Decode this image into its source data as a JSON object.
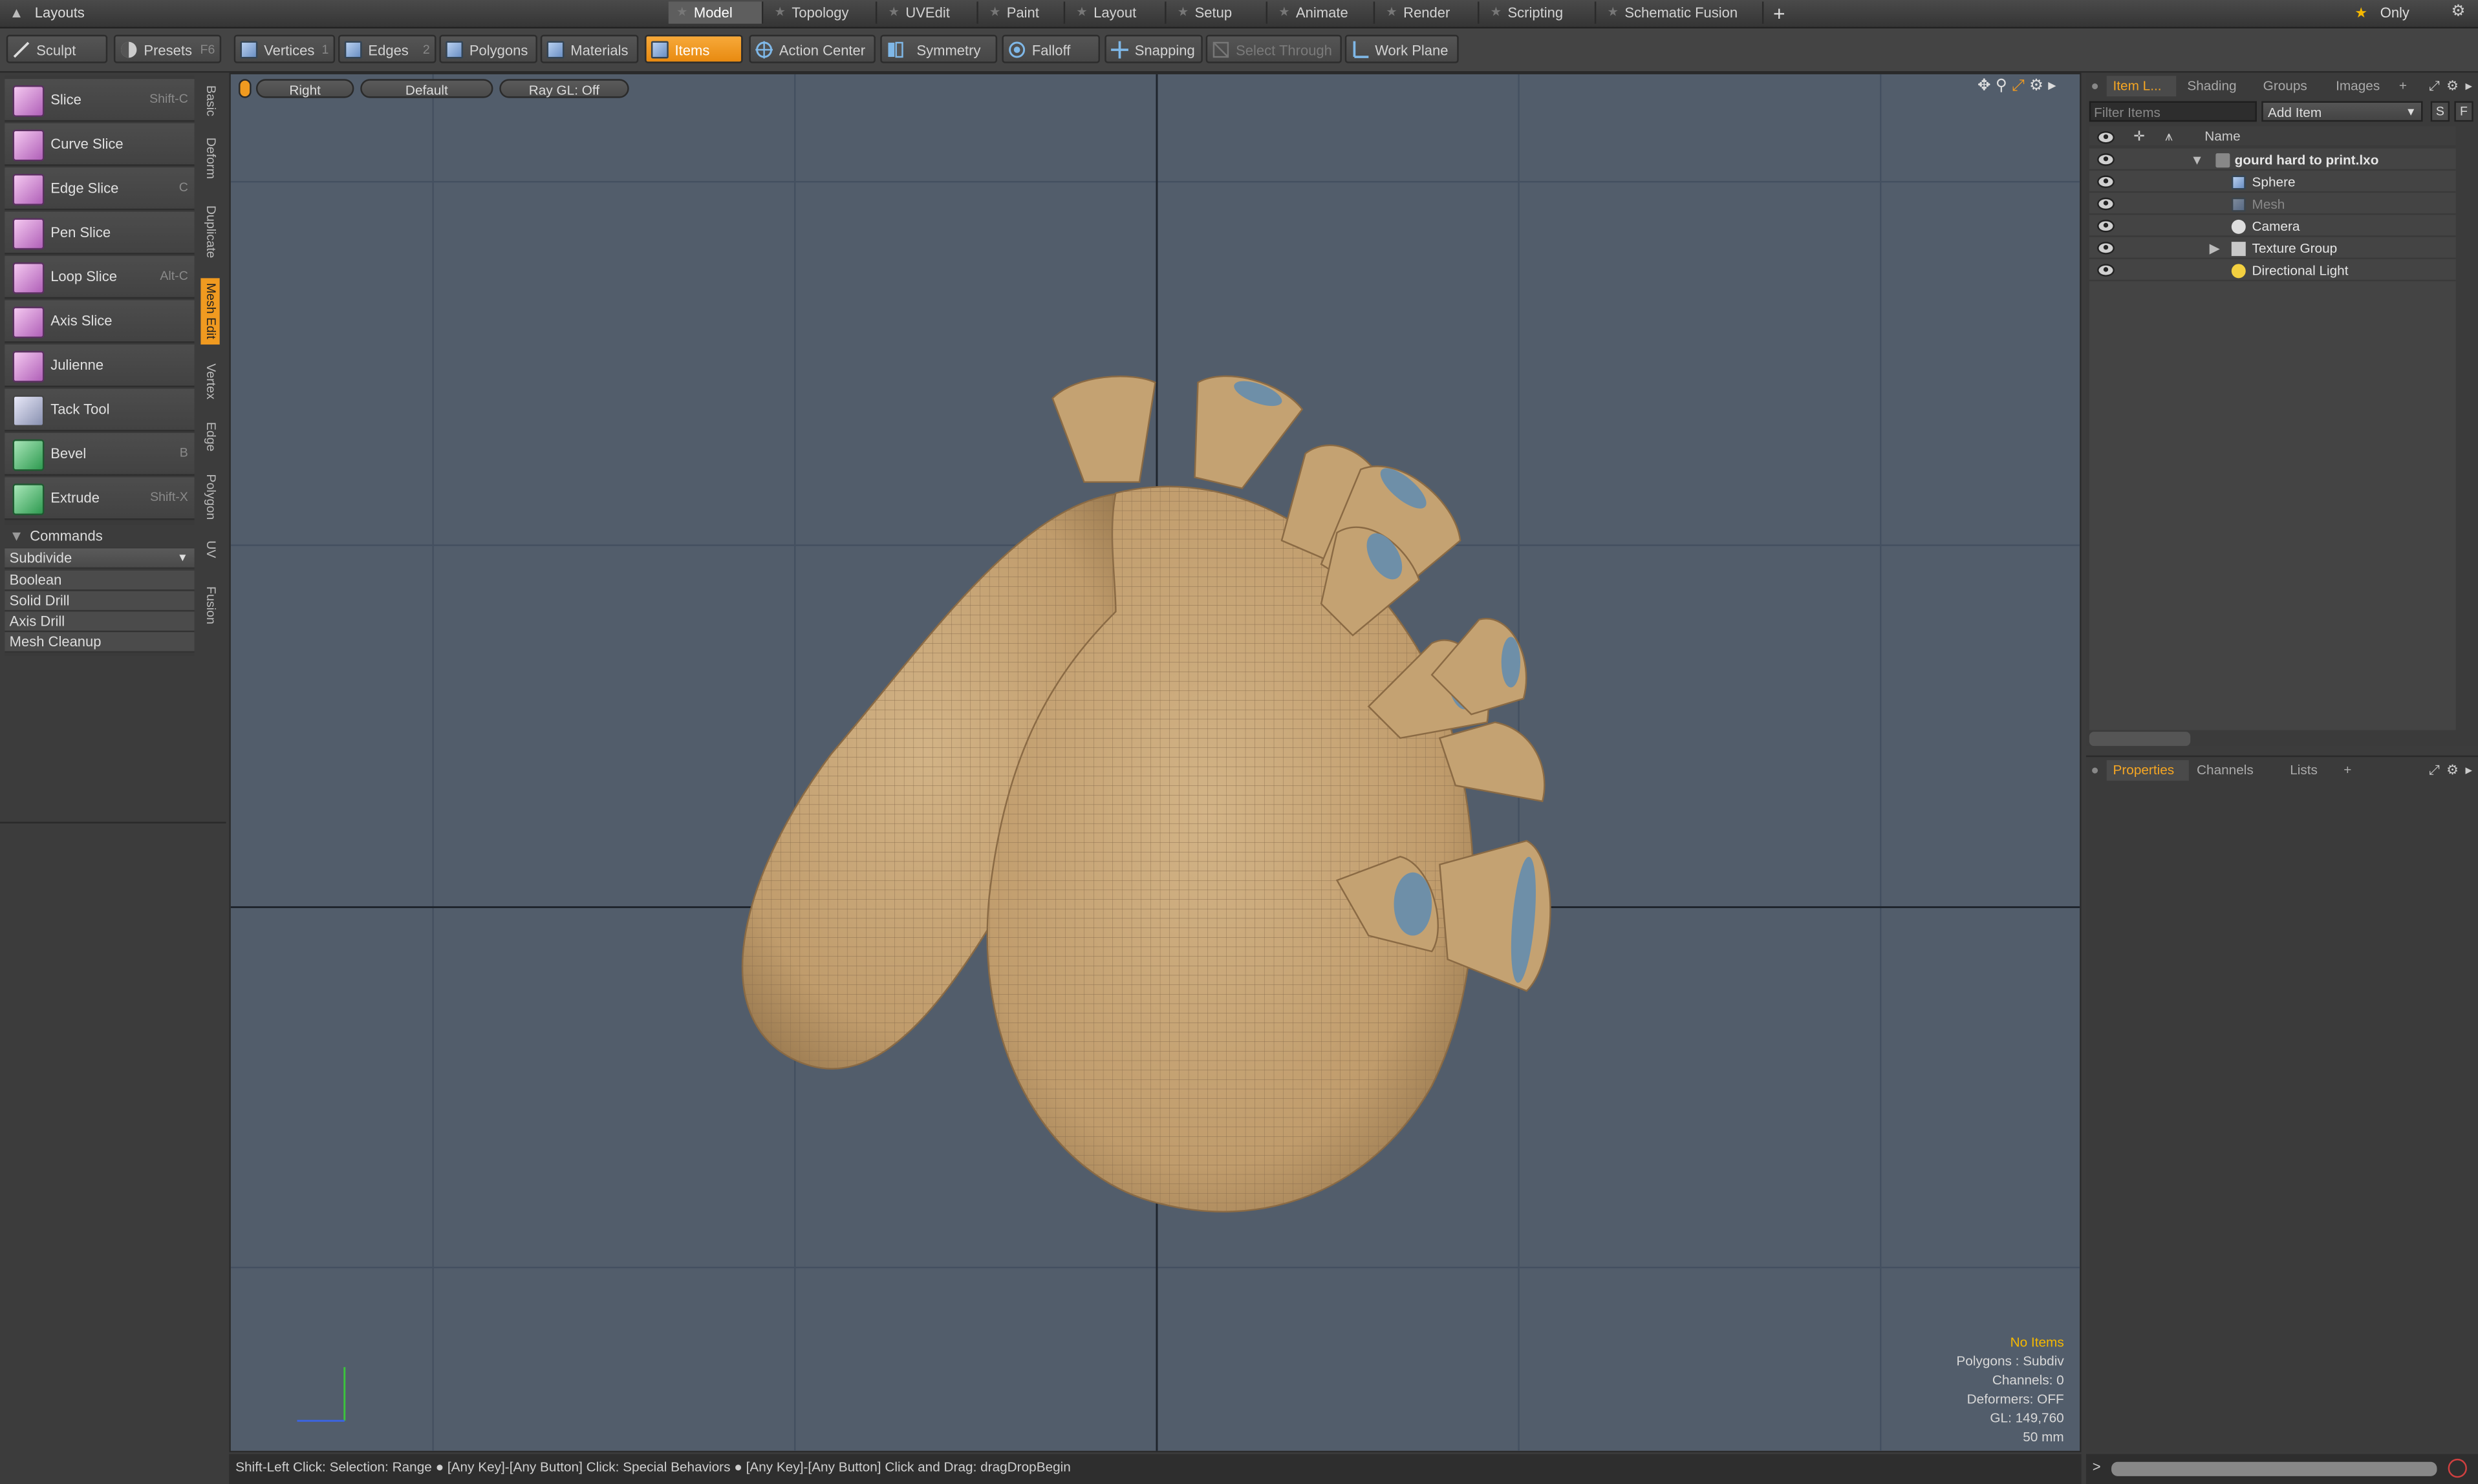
{
  "menubar": {
    "layouts_label": "Layouts",
    "tabs": [
      "Model",
      "Topology",
      "UVEdit",
      "Paint",
      "Layout",
      "Setup",
      "Animate",
      "Render",
      "Scripting",
      "Schematic Fusion"
    ],
    "active_tab": "Model",
    "add_tab_label": "+",
    "only_label": "Only"
  },
  "toolbar": {
    "sculpt": "Sculpt",
    "presets": "Presets",
    "presets_key": "F6",
    "vertices": "Vertices",
    "vertices_key": "1",
    "edges": "Edges",
    "edges_key": "2",
    "polygons": "Polygons",
    "materials": "Materials",
    "items": "Items",
    "action_center": "Action Center",
    "symmetry": "Symmetry",
    "falloff": "Falloff",
    "snapping": "Snapping",
    "select_through": "Select Through",
    "work_plane": "Work Plane"
  },
  "tools": [
    {
      "label": "Slice",
      "key": "Shift-C"
    },
    {
      "label": "Curve Slice",
      "key": ""
    },
    {
      "label": "Edge Slice",
      "key": "C"
    },
    {
      "label": "Pen Slice",
      "key": ""
    },
    {
      "label": "Loop Slice",
      "key": "Alt-C"
    },
    {
      "label": "Axis Slice",
      "key": ""
    },
    {
      "label": "Julienne",
      "key": ""
    },
    {
      "label": "Tack Tool",
      "key": ""
    },
    {
      "label": "Bevel",
      "key": "B"
    },
    {
      "label": "Extrude",
      "key": "Shift-X"
    }
  ],
  "commands": {
    "header": "Commands",
    "dropdown": "Subdivide",
    "items": [
      "Boolean",
      "Solid Drill",
      "Axis Drill",
      "Mesh Cleanup"
    ]
  },
  "vertical_tabs": [
    "Basic",
    "Deform",
    "Duplicate",
    "Mesh Edit",
    "Vertex",
    "Edge",
    "Polygon",
    "UV",
    "Fusion"
  ],
  "viewport": {
    "view": "Right",
    "style": "Default",
    "raygl": "Ray GL: Off",
    "info": [
      "No Items",
      "Polygons : Subdiv",
      "Channels: 0",
      "Deformers: OFF",
      "GL: 149,760",
      "50 mm"
    ]
  },
  "item_panel": {
    "tabs": [
      "Item L...",
      "Shading",
      "Groups",
      "Images",
      "+"
    ],
    "filter_placeholder": "Filter Items",
    "add_item": "Add Item",
    "s_btn": "S",
    "f_btn": "F",
    "name_header": "Name",
    "items": [
      {
        "name": "gourd hard to print.lxo",
        "type": "scene"
      },
      {
        "name": "Sphere",
        "type": "mesh"
      },
      {
        "name": "Mesh",
        "type": "mesh-disabled"
      },
      {
        "name": "Camera",
        "type": "camera"
      },
      {
        "name": "Texture Group",
        "type": "group"
      },
      {
        "name": "Directional Light",
        "type": "light"
      }
    ]
  },
  "props_panel": {
    "tabs": [
      "Properties",
      "Channels",
      "Lists",
      "+"
    ]
  },
  "statusbar": {
    "text": "Shift-Left Click: Selection: Range ● [Any Key]-[Any Button] Click: Special Behaviors ● [Any Key]-[Any Button] Click and Drag: dragDropBegin"
  },
  "colors": {
    "accent": "#f09a20",
    "viewport_bg": "#525d6b",
    "mesh": "#c6a577",
    "mesh_rim": "#6e8fa8"
  }
}
